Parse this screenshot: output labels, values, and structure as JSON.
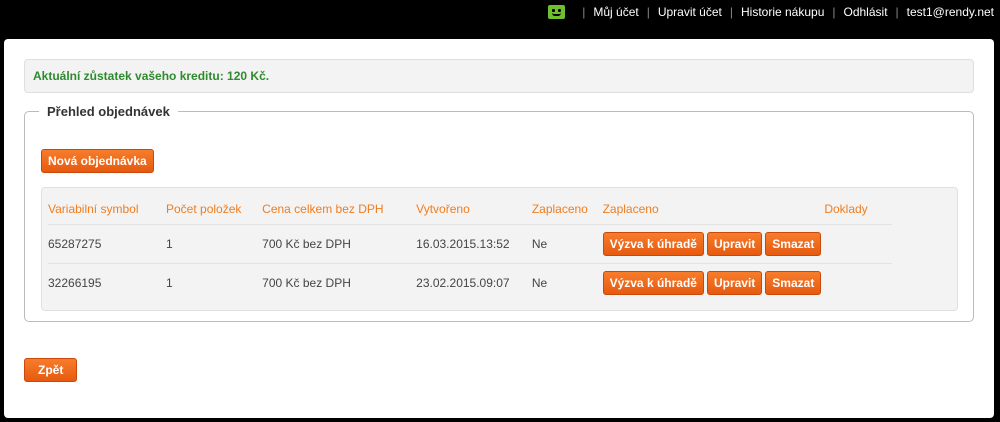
{
  "topnav": {
    "items": [
      "Můj účet",
      "Upravit účet",
      "Historie nákupu",
      "Odhlásit",
      "test1@rendy.net"
    ]
  },
  "credit": {
    "text": "Aktuální zůstatek vašeho kreditu: 120 Kč."
  },
  "orders": {
    "legend": "Přehled objednávek",
    "new_button": "Nová objednávka",
    "headers": [
      "Variabilní symbol",
      "Počet položek",
      "Cena celkem bez DPH",
      "Vytvořeno",
      "Zaplaceno",
      "Zaplaceno",
      "Doklady"
    ],
    "rows": [
      {
        "symbol": "65287275",
        "count": "1",
        "price": "700 Kč bez DPH",
        "created": "16.03.2015.13:52",
        "paid": "Ne",
        "actions": [
          "Výzva k úhradě",
          "Upravit",
          "Smazat"
        ]
      },
      {
        "symbol": "32266195",
        "count": "1",
        "price": "700 Kč bez DPH",
        "created": "23.02.2015.09:07",
        "paid": "Ne",
        "actions": [
          "Výzva k úhradě",
          "Upravit",
          "Smazat"
        ]
      }
    ]
  },
  "back_button": "Zpět",
  "colors": {
    "accent": "#f07d20",
    "button": "#e65a10",
    "credit_text": "#2e8b2e"
  },
  "icons": {
    "user_status": "smiley-icon"
  }
}
